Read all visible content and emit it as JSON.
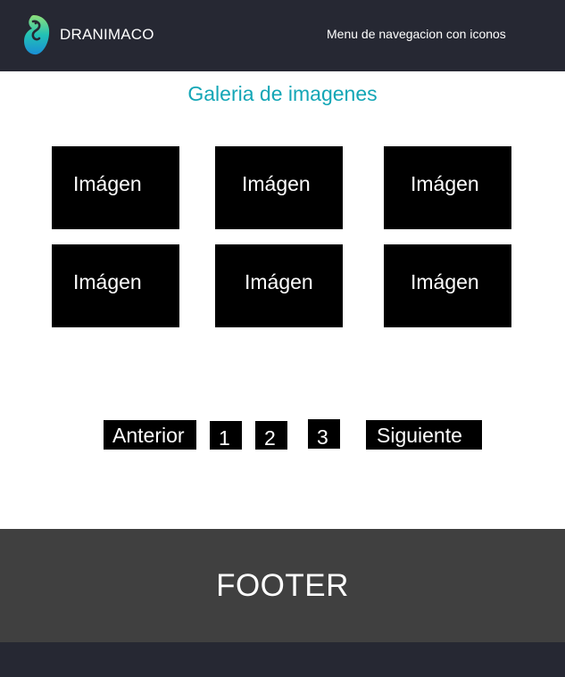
{
  "header": {
    "brand": "DRANIMACO",
    "nav_label": "Menu de navegacion con iconos",
    "logo_icon": "seahorse-logo-icon"
  },
  "gallery": {
    "title": "Galeria de imagenes",
    "tiles": [
      {
        "label": "Imágen"
      },
      {
        "label": "Imágen"
      },
      {
        "label": "Imágen"
      },
      {
        "label": "Imágen"
      },
      {
        "label": "Imágen"
      },
      {
        "label": "Imágen"
      }
    ]
  },
  "pagination": {
    "prev_label": "Anterior",
    "pages": [
      "1",
      "2",
      "3"
    ],
    "next_label": "Siguiente"
  },
  "footer": {
    "text": "FOOTER"
  },
  "colors": {
    "header_bg": "#262833",
    "accent": "#13a6b6",
    "footer_bg": "#404040",
    "tile_bg": "#000000"
  }
}
